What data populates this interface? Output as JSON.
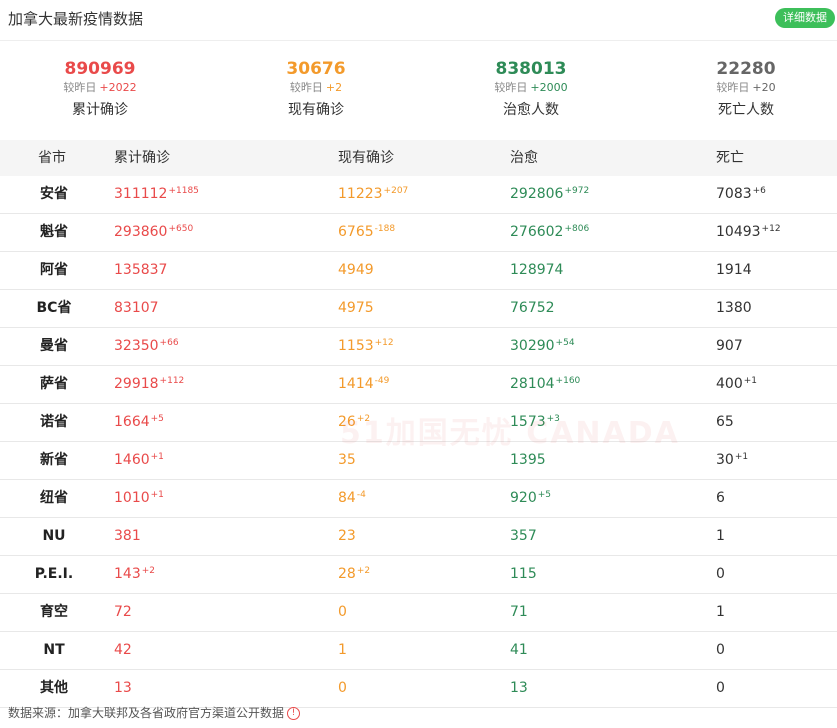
{
  "header": {
    "title": "加拿大最新疫情数据",
    "detail_button": "详细数据"
  },
  "stats": [
    {
      "value": "890969",
      "delta_label": "较昨日",
      "delta": "+2022",
      "label": "累计确诊",
      "color": "#e94a4a"
    },
    {
      "value": "30676",
      "delta_label": "较昨日",
      "delta": "+2",
      "label": "现有确诊",
      "color": "#f39a2b"
    },
    {
      "value": "838013",
      "delta_label": "较昨日",
      "delta": "+2000",
      "label": "治愈人数",
      "color": "#2e8b57"
    },
    {
      "value": "22280",
      "delta_label": "较昨日",
      "delta": "+20",
      "label": "死亡人数",
      "color": "#666666"
    }
  ],
  "table": {
    "headers": [
      "省市",
      "累计确诊",
      "现有确诊",
      "治愈",
      "死亡"
    ],
    "rows": [
      {
        "prov": "安省",
        "total": "311112",
        "total_d": "+1185",
        "active": "11223",
        "active_d": "+207",
        "cured": "292806",
        "cured_d": "+972",
        "dead": "7083",
        "dead_d": "+6"
      },
      {
        "prov": "魁省",
        "total": "293860",
        "total_d": "+650",
        "active": "6765",
        "active_d": "-188",
        "cured": "276602",
        "cured_d": "+806",
        "dead": "10493",
        "dead_d": "+12"
      },
      {
        "prov": "阿省",
        "total": "135837",
        "total_d": "",
        "active": "4949",
        "active_d": "",
        "cured": "128974",
        "cured_d": "",
        "dead": "1914",
        "dead_d": ""
      },
      {
        "prov": "BC省",
        "total": "83107",
        "total_d": "",
        "active": "4975",
        "active_d": "",
        "cured": "76752",
        "cured_d": "",
        "dead": "1380",
        "dead_d": ""
      },
      {
        "prov": "曼省",
        "total": "32350",
        "total_d": "+66",
        "active": "1153",
        "active_d": "+12",
        "cured": "30290",
        "cured_d": "+54",
        "dead": "907",
        "dead_d": ""
      },
      {
        "prov": "萨省",
        "total": "29918",
        "total_d": "+112",
        "active": "1414",
        "active_d": "-49",
        "cured": "28104",
        "cured_d": "+160",
        "dead": "400",
        "dead_d": "+1"
      },
      {
        "prov": "诺省",
        "total": "1664",
        "total_d": "+5",
        "active": "26",
        "active_d": "+2",
        "cured": "1573",
        "cured_d": "+3",
        "dead": "65",
        "dead_d": ""
      },
      {
        "prov": "新省",
        "total": "1460",
        "total_d": "+1",
        "active": "35",
        "active_d": "",
        "cured": "1395",
        "cured_d": "",
        "dead": "30",
        "dead_d": "+1"
      },
      {
        "prov": "纽省",
        "total": "1010",
        "total_d": "+1",
        "active": "84",
        "active_d": "-4",
        "cured": "920",
        "cured_d": "+5",
        "dead": "6",
        "dead_d": ""
      },
      {
        "prov": "NU",
        "total": "381",
        "total_d": "",
        "active": "23",
        "active_d": "",
        "cured": "357",
        "cured_d": "",
        "dead": "1",
        "dead_d": ""
      },
      {
        "prov": "P.E.I.",
        "total": "143",
        "total_d": "+2",
        "active": "28",
        "active_d": "+2",
        "cured": "115",
        "cured_d": "",
        "dead": "0",
        "dead_d": ""
      },
      {
        "prov": "育空",
        "total": "72",
        "total_d": "",
        "active": "0",
        "active_d": "",
        "cured": "71",
        "cured_d": "",
        "dead": "1",
        "dead_d": ""
      },
      {
        "prov": "NT",
        "total": "42",
        "total_d": "",
        "active": "1",
        "active_d": "",
        "cured": "41",
        "cured_d": "",
        "dead": "0",
        "dead_d": ""
      },
      {
        "prov": "其他",
        "total": "13",
        "total_d": "",
        "active": "0",
        "active_d": "",
        "cured": "13",
        "cured_d": "",
        "dead": "0",
        "dead_d": ""
      }
    ]
  },
  "watermark": "51加国无忧 CANADA",
  "footer": {
    "text": "数据来源：加拿大联邦及各省政府官方渠道公开数据",
    "icon": "info-icon"
  }
}
